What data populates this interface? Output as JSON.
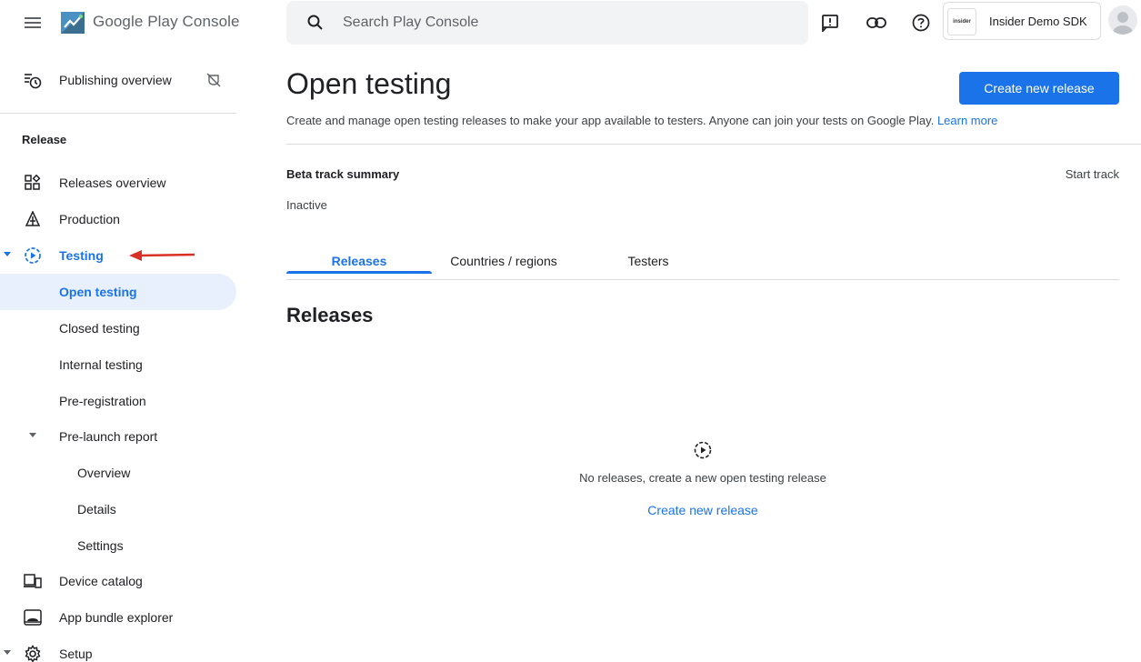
{
  "header": {
    "brand": "Google Play Console",
    "search_placeholder": "Search Play Console",
    "account_name": "Insider Demo SDK",
    "account_logo_text": "insider"
  },
  "sidebar": {
    "publishing_overview": "Publishing overview",
    "section_release": "Release",
    "items": {
      "releases_overview": "Releases overview",
      "production": "Production",
      "testing": "Testing",
      "open_testing": "Open testing",
      "closed_testing": "Closed testing",
      "internal_testing": "Internal testing",
      "pre_registration": "Pre-registration",
      "pre_launch_report": "Pre-launch report",
      "overview": "Overview",
      "details": "Details",
      "settings": "Settings",
      "device_catalog": "Device catalog",
      "app_bundle_explorer": "App bundle explorer",
      "setup": "Setup"
    }
  },
  "main": {
    "title": "Open testing",
    "create_button": "Create new release",
    "subtitle": "Create and manage open testing releases to make your app available to testers. Anyone can join your tests on Google Play.",
    "learn_more": "Learn more",
    "track_summary_title": "Beta track summary",
    "track_status": "Inactive",
    "start_track": "Start track",
    "tabs": [
      "Releases",
      "Countries / regions",
      "Testers"
    ],
    "releases_heading": "Releases",
    "empty_message": "No releases, create a new open testing release",
    "empty_link": "Create new release"
  },
  "colors": {
    "accent": "#1a73e8",
    "active_bg": "#e8f0fe",
    "annotation_arrow": "#d93025"
  }
}
